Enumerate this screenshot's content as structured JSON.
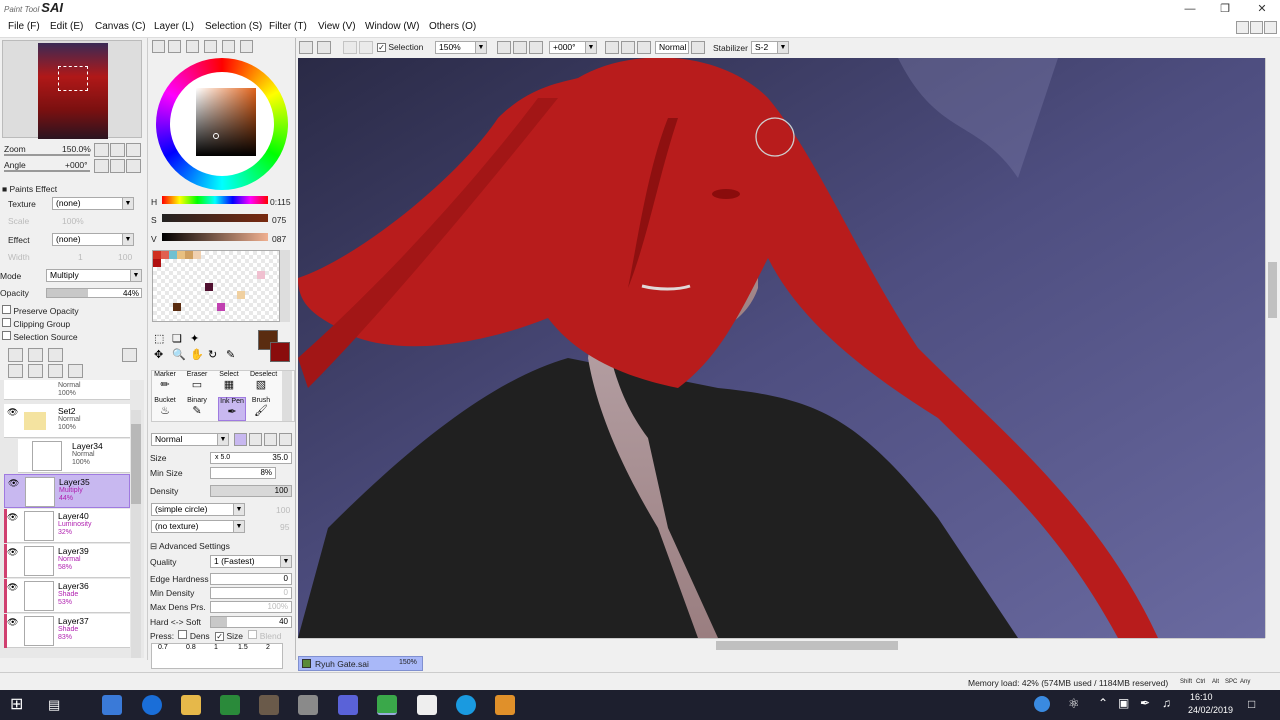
{
  "app": {
    "title_prefix": "Paint Tool",
    "title": "SAI"
  },
  "menu": [
    "File (F)",
    "Edit (E)",
    "Canvas (C)",
    "Layer (L)",
    "Selection (S)",
    "Filter (T)",
    "View (V)",
    "Window (W)",
    "Others (O)"
  ],
  "navigator": {
    "zoom_label": "Zoom",
    "zoom_value": "150.0%",
    "angle_label": "Angle",
    "angle_value": "+000°"
  },
  "paints_effect": {
    "title": "Paints Effect",
    "texture_label": "Texture",
    "texture_value": "(none)",
    "scale_label": "Scale",
    "scale_value": "100%",
    "effect_label": "Effect",
    "effect_value": "(none)",
    "width_label": "Width",
    "width_value": "1",
    "width_value2": "100"
  },
  "layer_props": {
    "mode_label": "Mode",
    "mode_value": "Multiply",
    "opacity_label": "Opacity",
    "opacity_value": "44%",
    "preserve_opacity": "Preserve Opacity",
    "clipping_group": "Clipping Group",
    "selection_source": "Selection Source"
  },
  "layers": [
    {
      "name": "",
      "mode": "Normal",
      "opacity": "100%"
    },
    {
      "name": "Set2",
      "mode": "Normal",
      "opacity": "100%"
    },
    {
      "name": "Layer34",
      "mode": "Normal",
      "opacity": "100%"
    },
    {
      "name": "Layer35",
      "mode": "Multiply",
      "opacity": "44%"
    },
    {
      "name": "Layer40",
      "mode": "Luminosity",
      "opacity": "32%"
    },
    {
      "name": "Layer39",
      "mode": "Normal",
      "opacity": "58%"
    },
    {
      "name": "Layer36",
      "mode": "Shade",
      "opacity": "53%"
    },
    {
      "name": "Layer37",
      "mode": "Shade",
      "opacity": "83%"
    }
  ],
  "color": {
    "h_label": "H",
    "h_value": "0:115",
    "s_label": "S",
    "s_value": "075",
    "v_label": "V",
    "v_value": "087",
    "primary": "#5a2c10",
    "secondary": "#8a0c0c"
  },
  "tools": {
    "row1": [
      "Marker",
      "Eraser",
      "Select",
      "Deselect"
    ],
    "row2": [
      "Bucket",
      "Binary",
      "Ink Pen",
      "Brush"
    ],
    "selected": "Ink Pen"
  },
  "brush": {
    "blend_mode": "Normal",
    "size_label": "Size",
    "size_mult": "x 5.0",
    "size_value": "35.0",
    "minsize_label": "Min Size",
    "minsize_value": "8%",
    "density_label": "Density",
    "density_value": "100",
    "shape": "(simple circle)",
    "shape_value": "100",
    "texture": "(no texture)",
    "texture_value": "95",
    "advanced": "Advanced Settings",
    "quality_label": "Quality",
    "quality_value": "1 (Fastest)",
    "edge_label": "Edge Hardness",
    "edge_value": "0",
    "mindens_label": "Min Density",
    "mindens_value": "0",
    "maxdens_label": "Max Dens Prs.",
    "maxdens_value": "100%",
    "hardsoft_label": "Hard <-> Soft",
    "hardsoft_value": "40",
    "press_label": "Press:",
    "dens_label": "Dens",
    "size_chk_label": "Size",
    "blend_label": "Blend",
    "size_presets": [
      "0.7",
      "0.8",
      "1",
      "1.5",
      "2"
    ]
  },
  "toolbar": {
    "selection_label": "Selection",
    "zoom_value": "150%",
    "angle_value": "+000°",
    "mode_value": "Normal",
    "stabilizer_label": "Stabilizer",
    "stabilizer_value": "S-2"
  },
  "document": {
    "name": "Ryuh Gate.sai",
    "zoom": "150%"
  },
  "status": {
    "memory": "Memory load: 42% (574MB used / 1184MB reserved)",
    "keys": [
      "Shift",
      "Ctrl",
      "Alt",
      "SPC",
      "Any"
    ]
  },
  "taskbar": {
    "time": "16:10",
    "date": "24/02/2019"
  },
  "colors": {
    "accent": "#c8b8f0",
    "hair": "#b81c1c",
    "sky": "#4a4a78"
  }
}
